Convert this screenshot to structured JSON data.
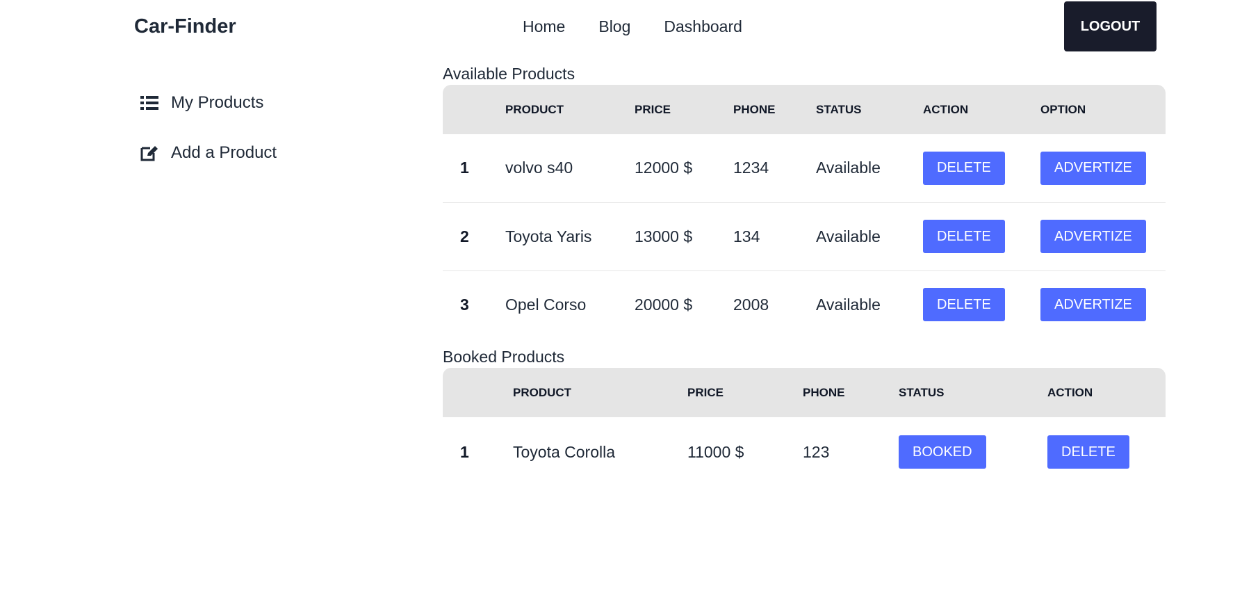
{
  "nav": {
    "brand": "Car-Finder",
    "links": [
      "Home",
      "Blog",
      "Dashboard"
    ],
    "logout_label": "LOGOUT"
  },
  "sidebar": {
    "items": [
      {
        "label": "My Products",
        "icon": "list-icon"
      },
      {
        "label": "Add a Product",
        "icon": "edit-icon"
      }
    ]
  },
  "available": {
    "title": "Available Products",
    "headers": [
      "",
      "PRODUCT",
      "PRICE",
      "PHONE",
      "STATUS",
      "ACTION",
      "OPTION"
    ],
    "rows": [
      {
        "index": "1",
        "product": "volvo s40",
        "price": "12000 $",
        "phone": "1234",
        "status": "Available",
        "action": "DELETE",
        "option": "ADVERTIZE"
      },
      {
        "index": "2",
        "product": "Toyota Yaris",
        "price": "13000 $",
        "phone": "134",
        "status": "Available",
        "action": "DELETE",
        "option": "ADVERTIZE"
      },
      {
        "index": "3",
        "product": "Opel Corso",
        "price": "20000 $",
        "phone": "2008",
        "status": "Available",
        "action": "DELETE",
        "option": "ADVERTIZE"
      }
    ]
  },
  "booked": {
    "title": "Booked Products",
    "headers": [
      "",
      "PRODUCT",
      "PRICE",
      "PHONE",
      "STATUS",
      "ACTION"
    ],
    "rows": [
      {
        "index": "1",
        "product": "Toyota Corolla",
        "price": "11000 $",
        "phone": "123",
        "status": "BOOKED",
        "action": "DELETE"
      }
    ]
  },
  "colors": {
    "accent": "#4f6bff",
    "dark": "#191c2b",
    "header_bg": "#e5e5e5"
  }
}
